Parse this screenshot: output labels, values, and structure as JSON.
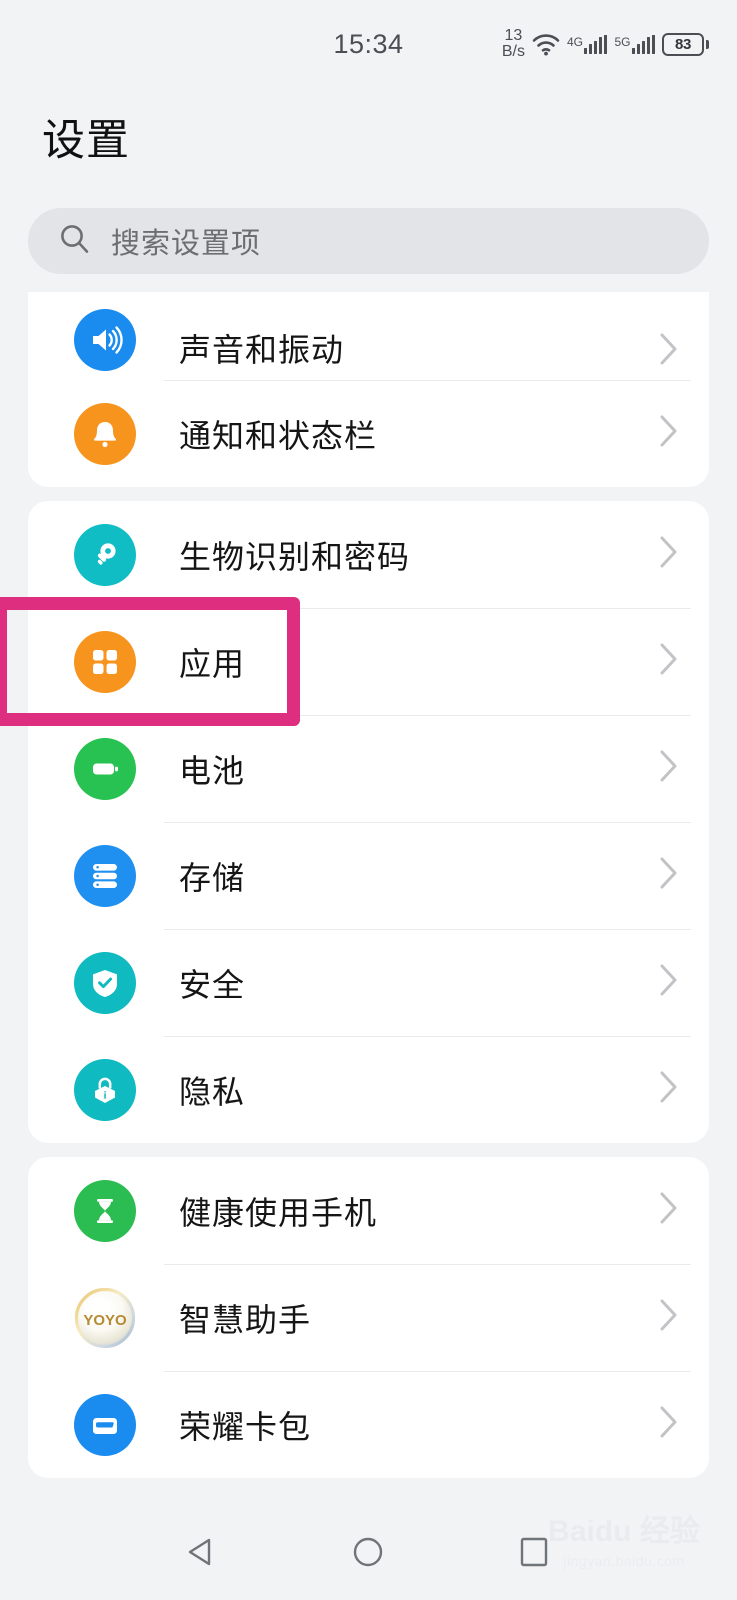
{
  "status_bar": {
    "time": "15:34",
    "net_speed_value": "13",
    "net_speed_unit": "B/s",
    "wifi_icon": "wifi-icon",
    "sim1_gen": "4G",
    "sim2_gen": "5G",
    "battery_level": "83"
  },
  "header": {
    "title": "设置"
  },
  "search": {
    "placeholder": "搜索设置项",
    "icon": "search-icon"
  },
  "highlight": {
    "color": "#DE2E7F",
    "target": "应用"
  },
  "groups": [
    {
      "id": "group-sound",
      "items": [
        {
          "label": "声音和振动",
          "icon": "volume-icon",
          "color": "#1A8CF0"
        },
        {
          "label": "通知和状态栏",
          "icon": "bell-icon",
          "color": "#F7941D"
        }
      ]
    },
    {
      "id": "group-system",
      "items": [
        {
          "label": "生物识别和密码",
          "icon": "key-icon",
          "color": "#11BDC4"
        },
        {
          "label": "应用",
          "icon": "apps-grid-icon",
          "color": "#F7941D"
        },
        {
          "label": "电池",
          "icon": "battery-icon",
          "color": "#27C252"
        },
        {
          "label": "存储",
          "icon": "storage-icon",
          "color": "#2090F0"
        },
        {
          "label": "安全",
          "icon": "shield-check-icon",
          "color": "#0FBAC0"
        },
        {
          "label": "隐私",
          "icon": "privacy-lock-icon",
          "color": "#0FBAC0"
        }
      ]
    },
    {
      "id": "group-assistant",
      "items": [
        {
          "label": "健康使用手机",
          "icon": "hourglass-icon",
          "color": "#2CBD52"
        },
        {
          "label": "智慧助手",
          "icon": "yoyo-pearl-icon",
          "color": "#EFE6CE"
        },
        {
          "label": "荣耀卡包",
          "icon": "wallet-icon",
          "color": "#1A8CF0"
        }
      ]
    }
  ],
  "nav_bar": {
    "back": "back-triangle-icon",
    "home": "home-circle-icon",
    "recents": "recents-square-icon"
  },
  "watermark": {
    "main": "Baidu 经验",
    "sub": "jingyan.baidu.com"
  }
}
